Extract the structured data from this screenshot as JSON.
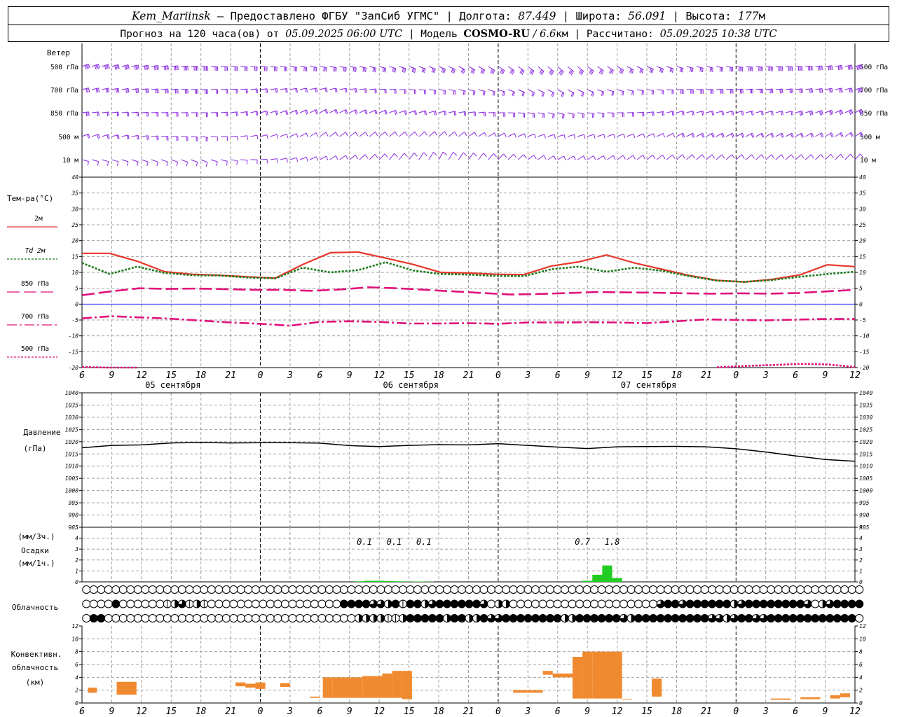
{
  "header": {
    "station": "Kem_Mariinsk",
    "line1_text": " – Предоставлено ФГБУ \"ЗапСиб УГМС\" | Долгота: ",
    "lon": "87.449",
    "line1_lat_label": " | Широта: ",
    "lat": "56.091",
    "line1_alt_label": " | Высота: ",
    "alt": "177",
    "alt_unit": "м",
    "line2_prefix": "Прогноз на 120 часа(ов) от ",
    "forecast_start": "05.09.2025 06:00 UTC",
    "line2_model_label": " | Модель ",
    "model": "COSMO-RU",
    "model_res": " / 6.6",
    "model_res_unit": "км",
    "line2_calc_label": " | Рассчитано: ",
    "calc_time": "05.09.2025 10:38 UTC"
  },
  "labels": {
    "wind_title": "Ветер",
    "wind_levels": [
      "500 гПа",
      "700 гПа",
      "850 гПа",
      "500 м",
      "10 м"
    ],
    "temp_title": "Тем-ра(°С)",
    "temp_series": [
      "2м",
      "Td  2м",
      "850 гПа",
      "700 гПа",
      "500 гПа"
    ],
    "pressure_title": "Давление",
    "pressure_unit": "(гПа)",
    "precip_unit_3h": "(мм/3ч.)",
    "precip_title": "Осадки",
    "precip_unit_1h": "(мм/1ч.)",
    "cloud_title": "Облачность",
    "conv_title_1": "Конвективн.",
    "conv_title_2": "облачность",
    "conv_unit": "(км)"
  },
  "time_axis": {
    "hour_labels": [
      "6",
      "9",
      "12",
      "15",
      "18",
      "21",
      "0",
      "3",
      "6",
      "9",
      "12",
      "15",
      "18",
      "21",
      "0",
      "3",
      "6",
      "9",
      "12",
      "15",
      "18",
      "21",
      "0",
      "3",
      "6",
      "9",
      "12"
    ],
    "dates": [
      "05 сентября",
      "06 сентября",
      "07 сентября"
    ],
    "start_hour": 6,
    "hours_span": 78
  },
  "colors": {
    "t2m": "#e8362a",
    "td2m": "#1a7a1a",
    "t850": "#e0107a",
    "t700": "#e0107a",
    "t500": "#e0107a",
    "zero": "#3030ff",
    "wind": "#8a2be2",
    "pressure": "#000000",
    "precip": "#22cc22",
    "convective": "#f08a30",
    "grid": "#a0a0a0"
  },
  "chart_data": [
    {
      "type": "line",
      "title": "Тем-ра(°С)",
      "x_hours": [
        0,
        3,
        6,
        9,
        12,
        15,
        18,
        21,
        24,
        27,
        30,
        33,
        36,
        39,
        42,
        45,
        48,
        51,
        54,
        57,
        60,
        63,
        66,
        69,
        72,
        75,
        78
      ],
      "ylim": [
        -20,
        40
      ],
      "yticks": [
        -20,
        -15,
        -10,
        -5,
        0,
        5,
        10,
        15,
        20,
        25,
        30,
        35,
        40
      ],
      "series": [
        {
          "name": "2м",
          "key": "t2m",
          "dash": "",
          "values": [
            16,
            16,
            13.5,
            10.2,
            9.4,
            9.1,
            8.6,
            8.2,
            12.5,
            16.2,
            16.4,
            14.5,
            12.5,
            10,
            9.8,
            9.4,
            9.3,
            12,
            13.3,
            15.5,
            13,
            11,
            9,
            7.5,
            7,
            7.8,
            9.2,
            12.4,
            11.8
          ]
        },
        {
          "name": "Td  2м",
          "key": "td2m",
          "dash": "3,2",
          "values": [
            13,
            9.5,
            11.8,
            9.8,
            9.1,
            9,
            8.4,
            8.1,
            11.5,
            10,
            10.7,
            13.2,
            10.6,
            9.5,
            9.3,
            8.9,
            8.8,
            11,
            11.8,
            10.2,
            11.5,
            10.5,
            8.8,
            7.4,
            7,
            7.6,
            8.6,
            9.5,
            10.2
          ]
        },
        {
          "name": "850 гПа",
          "key": "t850",
          "dash": "18,6",
          "values": [
            2.8,
            4,
            5,
            4.8,
            4.9,
            4.7,
            4.5,
            4.5,
            4.2,
            4.6,
            5.3,
            5,
            4.5,
            4,
            3.5,
            3,
            3.2,
            3.5,
            3.8,
            3.7,
            3.6,
            3.4,
            3.3,
            3.4,
            3.3,
            3.5,
            4,
            4.5
          ]
        },
        {
          "name": "700 гПа",
          "key": "t700",
          "dash": "14,4,3,4",
          "values": [
            -4.5,
            -3.8,
            -4.2,
            -4.6,
            -5.2,
            -5.8,
            -6.2,
            -6.8,
            -5.6,
            -5.4,
            -5.6,
            -6.1,
            -6.1,
            -6,
            -6.2,
            -5.8,
            -5.8,
            -5.7,
            -5.8,
            -6,
            -5.4,
            -4.8,
            -5,
            -5.1,
            -4.9,
            -4.7,
            -4.7
          ]
        },
        {
          "name": "500 гПа",
          "key": "t500",
          "dash": "3,2",
          "values": [
            -19.8,
            -20,
            -20,
            null,
            null,
            null,
            null,
            null,
            null,
            null,
            null,
            null,
            null,
            null,
            null,
            null,
            null,
            null,
            null,
            null,
            null,
            null,
            null,
            -19.9,
            -19.5,
            -19.2,
            -18.8,
            -19,
            -19.8
          ]
        }
      ]
    },
    {
      "type": "line",
      "title": "Давление",
      "x_hours": [
        0,
        3,
        6,
        9,
        12,
        15,
        18,
        21,
        24,
        27,
        30,
        33,
        36,
        39,
        42,
        45,
        48,
        51,
        54,
        57,
        60,
        63,
        66,
        69,
        72,
        75,
        78
      ],
      "ylim": [
        985,
        1040
      ],
      "yticks": [
        985,
        990,
        995,
        1000,
        1005,
        1010,
        1015,
        1020,
        1025,
        1030,
        1035,
        1040
      ],
      "values": [
        1017.5,
        1018.5,
        1018.7,
        1019.5,
        1019.7,
        1019.5,
        1019.6,
        1019.6,
        1019.4,
        1018.4,
        1018.0,
        1018.5,
        1018.8,
        1018.7,
        1019.2,
        1018.5,
        1017.8,
        1017.2,
        1017.9,
        1018.0,
        1018.1,
        1017.9,
        1017.1,
        1015.8,
        1014.2,
        1012.7,
        1012.0
      ]
    },
    {
      "type": "bar",
      "title": "Осадки",
      "ylim": [
        0,
        5
      ],
      "yticks": [
        0,
        1,
        2,
        3,
        4,
        5
      ],
      "hours": [
        24,
        25,
        26,
        27,
        28,
        29,
        30,
        31,
        32,
        33,
        34,
        35,
        36,
        37,
        38,
        39,
        40,
        41,
        42,
        43,
        44,
        45,
        46,
        47,
        48,
        49,
        50,
        51,
        52,
        53,
        54
      ],
      "values_1h": [
        0,
        0,
        0,
        0,
        0.05,
        0.1,
        0.1,
        0.08,
        0.05,
        0.02,
        0.03,
        0.02,
        0,
        0,
        0,
        0,
        0,
        0,
        0,
        0,
        0,
        0,
        0,
        0,
        0,
        0,
        0,
        0.1,
        0.65,
        1.5,
        0.35
      ],
      "labels_3h": [
        {
          "hour": 30,
          "text": "0.1"
        },
        {
          "hour": 33,
          "text": "0.1"
        },
        {
          "hour": 36,
          "text": "0.1"
        },
        {
          "hour": 52,
          "text": "0.7"
        },
        {
          "hour": 55,
          "text": "1.8"
        }
      ]
    },
    {
      "type": "bar",
      "title": "Конвективн. облачность",
      "ylim": [
        0,
        12
      ],
      "yticks": [
        0,
        2,
        4,
        6,
        8,
        10,
        12
      ],
      "segments": [
        {
          "h0": 0.6,
          "h1": 1.5,
          "bottom": 1.6,
          "top": 2.4
        },
        {
          "h0": 3.5,
          "h1": 5.5,
          "bottom": 1.3,
          "top": 3.3
        },
        {
          "h0": 15.5,
          "h1": 16.5,
          "bottom": 2.6,
          "top": 3.2
        },
        {
          "h0": 16.5,
          "h1": 17.5,
          "bottom": 2.4,
          "top": 3.0
        },
        {
          "h0": 17.5,
          "h1": 18.5,
          "bottom": 2.2,
          "top": 3.2
        },
        {
          "h0": 20,
          "h1": 21,
          "bottom": 2.5,
          "top": 3.1
        },
        {
          "h0": 23,
          "h1": 24,
          "bottom": 0.8,
          "top": 1.0
        },
        {
          "h0": 24.3,
          "h1": 25.3,
          "bottom": 0.8,
          "top": 4.0
        },
        {
          "h0": 25.3,
          "h1": 28.3,
          "bottom": 0.8,
          "top": 4.0
        },
        {
          "h0": 28.3,
          "h1": 30.3,
          "bottom": 0.8,
          "top": 4.2
        },
        {
          "h0": 30.3,
          "h1": 31.3,
          "bottom": 0.8,
          "top": 4.6
        },
        {
          "h0": 31.3,
          "h1": 32.3,
          "bottom": 0.8,
          "top": 5.0
        },
        {
          "h0": 32.3,
          "h1": 33.3,
          "bottom": 0.6,
          "top": 5.0
        },
        {
          "h0": 43.5,
          "h1": 46.5,
          "bottom": 1.6,
          "top": 2.0
        },
        {
          "h0": 46.5,
          "h1": 47.5,
          "bottom": 4.4,
          "top": 5.0
        },
        {
          "h0": 47.5,
          "h1": 49.5,
          "bottom": 4.0,
          "top": 4.6
        },
        {
          "h0": 49.5,
          "h1": 50.5,
          "bottom": 0.7,
          "top": 7.2
        },
        {
          "h0": 50.5,
          "h1": 51.5,
          "bottom": 0.7,
          "top": 8.0
        },
        {
          "h0": 51.5,
          "h1": 54.5,
          "bottom": 0.7,
          "top": 8.0
        },
        {
          "h0": 54.5,
          "h1": 55.5,
          "bottom": 0.5,
          "top": 0.6
        },
        {
          "h0": 57.5,
          "h1": 58.5,
          "bottom": 1.0,
          "top": 3.8
        },
        {
          "h0": 69.5,
          "h1": 71.5,
          "bottom": 0.5,
          "top": 0.7
        },
        {
          "h0": 72.5,
          "h1": 74.5,
          "bottom": 0.6,
          "top": 0.9
        },
        {
          "h0": 75.5,
          "h1": 76.5,
          "bottom": 0.7,
          "top": 1.2
        },
        {
          "h0": 76.5,
          "h1": 77.5,
          "bottom": 0.9,
          "top": 1.5
        }
      ]
    }
  ],
  "wind": {
    "rows": 5,
    "profile": [
      {
        "h": 0,
        "dir": [
          255,
          260,
          265,
          255,
          280
        ],
        "spd": [
          40,
          30,
          25,
          20,
          10
        ]
      },
      {
        "h": 12,
        "dir": [
          270,
          270,
          270,
          275,
          285
        ],
        "spd": [
          35,
          25,
          20,
          15,
          10
        ]
      },
      {
        "h": 24,
        "dir": [
          275,
          260,
          250,
          245,
          250
        ],
        "spd": [
          30,
          20,
          15,
          10,
          5
        ]
      },
      {
        "h": 36,
        "dir": [
          285,
          275,
          260,
          240,
          220
        ],
        "spd": [
          30,
          20,
          15,
          10,
          5
        ]
      },
      {
        "h": 48,
        "dir": [
          300,
          290,
          280,
          260,
          250
        ],
        "spd": [
          25,
          20,
          15,
          10,
          5
        ]
      },
      {
        "h": 60,
        "dir": [
          280,
          270,
          260,
          250,
          240
        ],
        "spd": [
          30,
          25,
          20,
          15,
          10
        ]
      },
      {
        "h": 72,
        "dir": [
          270,
          265,
          260,
          250,
          240
        ],
        "spd": [
          40,
          30,
          25,
          15,
          10
        ]
      },
      {
        "h": 78,
        "dir": [
          260,
          260,
          250,
          245,
          235
        ],
        "spd": [
          45,
          35,
          30,
          20,
          10
        ]
      }
    ]
  },
  "clouds": {
    "rows": 3,
    "values": [
      [
        0,
        0,
        0,
        0,
        0,
        0,
        0,
        0,
        0,
        0,
        0,
        0,
        0,
        0,
        0,
        0,
        0,
        0,
        0,
        0,
        0,
        0,
        0,
        0,
        0,
        0,
        0,
        0,
        0,
        0,
        0,
        0,
        0,
        0,
        0,
        0,
        0,
        0,
        0,
        0,
        0,
        0,
        0,
        0,
        0,
        0,
        0,
        0,
        0,
        0,
        0,
        0,
        0,
        0,
        0,
        0,
        0,
        0,
        0,
        0,
        0,
        0,
        0,
        0,
        0,
        0,
        0,
        0,
        0,
        0,
        0,
        0,
        0,
        0,
        0,
        0,
        0,
        0,
        0,
        0,
        0,
        0,
        0,
        0,
        0,
        0,
        0,
        0,
        0,
        0,
        0,
        0,
        0,
        0,
        0,
        0,
        0,
        0,
        0,
        0,
        0,
        0,
        0,
        0,
        0,
        0
      ],
      [
        0,
        0,
        0,
        0,
        4,
        0,
        0,
        0,
        0,
        0,
        0,
        1,
        2,
        3,
        1,
        2,
        1,
        0,
        0,
        0,
        0,
        0,
        0,
        0,
        0,
        0,
        0,
        0,
        0,
        0,
        0,
        0,
        0,
        0,
        0,
        4,
        4,
        4,
        4,
        3,
        3,
        2,
        4,
        1,
        4,
        4,
        2,
        3,
        4,
        4,
        4,
        4,
        4,
        4,
        3,
        0,
        2,
        2,
        0,
        0,
        0,
        0,
        0,
        0,
        0,
        0,
        0,
        0,
        0,
        0,
        0,
        0,
        0,
        0,
        0,
        0,
        0,
        0,
        3,
        4,
        4,
        3,
        4,
        4,
        4,
        4,
        4,
        4,
        2,
        3,
        4,
        4,
        4,
        4,
        4,
        4,
        4,
        4,
        3,
        0,
        2,
        3,
        4,
        4,
        4,
        4
      ],
      [
        0,
        4,
        4,
        0,
        0,
        0,
        0,
        0,
        0,
        0,
        0,
        0,
        0,
        0,
        0,
        0,
        0,
        0,
        0,
        0,
        0,
        0,
        0,
        0,
        0,
        0,
        0,
        0,
        0,
        0,
        0,
        0,
        0,
        0,
        0,
        0,
        0,
        2,
        2,
        2,
        2,
        1,
        1,
        2,
        4,
        4,
        4,
        4,
        4,
        2,
        4,
        4,
        2,
        2,
        4,
        3,
        3,
        4,
        4,
        4,
        4,
        4,
        4,
        4,
        4,
        2,
        2,
        4,
        4,
        4,
        4,
        4,
        4,
        3,
        2,
        4,
        4,
        4,
        4,
        4,
        4,
        4,
        4,
        4,
        4,
        3,
        3,
        2,
        3,
        4,
        4,
        3,
        3,
        4,
        4,
        4,
        4,
        4,
        4,
        4,
        4,
        4,
        4,
        4,
        4,
        0
      ]
    ]
  }
}
